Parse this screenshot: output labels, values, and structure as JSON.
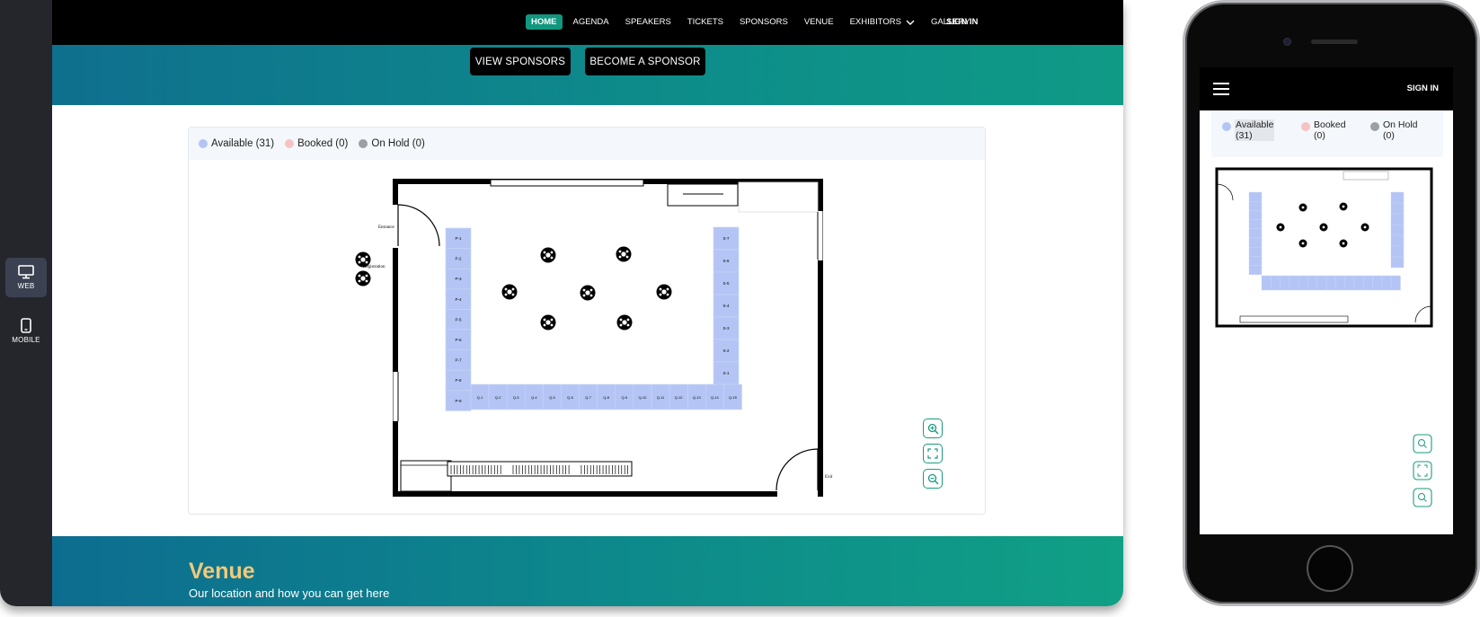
{
  "rail": {
    "web_label": "WEB",
    "mobile_label": "MOBILE"
  },
  "nav": {
    "items": [
      "HOME",
      "AGENDA",
      "SPEAKERS",
      "TICKETS",
      "SPONSORS",
      "VENUE",
      "EXHIBITORS",
      "GALLERY"
    ],
    "signin": "SIGN IN"
  },
  "hero": {
    "view_sponsors": "VIEW SPONSORS",
    "become_sponsor": "BECOME A SPONSOR"
  },
  "legend": {
    "available": "Available (31)",
    "booked": "Booked (0)",
    "on_hold": "On Hold (0)"
  },
  "floorplan": {
    "entrance_label": "Entrance",
    "registration_label": "Registration",
    "exit_label": "Exit",
    "booths_p": [
      "P-1",
      "P-2",
      "P-3",
      "P-4",
      "P-5",
      "P-6",
      "P-7",
      "P-8",
      "P-9"
    ],
    "booths_s": [
      "S-7",
      "S-6",
      "S-5",
      "S-4",
      "S-3",
      "S-2",
      "S-1"
    ],
    "booths_q": [
      "Q-1",
      "Q-2",
      "Q-3",
      "Q-4",
      "Q-5",
      "Q-6",
      "Q-7",
      "Q-8",
      "Q-9",
      "Q-10",
      "Q-11",
      "Q-12",
      "Q-13",
      "Q-14",
      "Q-15"
    ]
  },
  "venue": {
    "title": "Venue",
    "subtitle": "Our location and how you can get here"
  },
  "mobile": {
    "signin": "SIGN IN",
    "available_line1": "Available",
    "available_line2": "(31)",
    "booked_line1": "Booked",
    "booked_line2": "(0)",
    "onhold_line1": "On Hold",
    "onhold_line2": "(0)"
  },
  "colors": {
    "accent": "#12977f",
    "available": "#b4c5f5",
    "booked": "#f6c3c3",
    "on_hold": "#9aa0a6",
    "venue_title": "#f2c97a"
  }
}
